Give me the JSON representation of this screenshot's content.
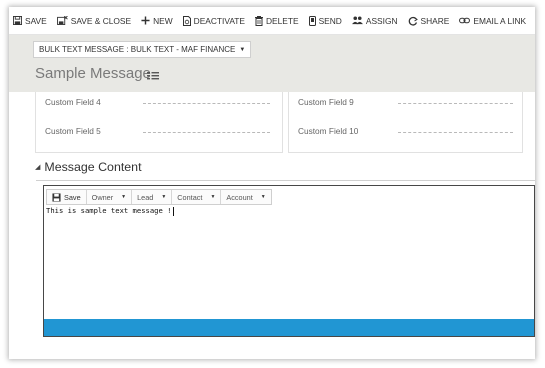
{
  "toolbar": {
    "items": [
      {
        "label": "SAVE",
        "icon": "save-icon"
      },
      {
        "label": "SAVE & CLOSE",
        "icon": "save-close-icon"
      },
      {
        "label": "NEW",
        "icon": "plus-icon"
      },
      {
        "label": "DEACTIVATE",
        "icon": "deactivate-icon"
      },
      {
        "label": "DELETE",
        "icon": "trash-icon"
      },
      {
        "label": "SEND",
        "icon": "send-icon"
      },
      {
        "label": "ASSIGN",
        "icon": "assign-icon"
      },
      {
        "label": "SHARE",
        "icon": "share-icon"
      },
      {
        "label": "EMAIL A LINK",
        "icon": "link-icon"
      }
    ],
    "more": "•••"
  },
  "header": {
    "entity": "BULK TEXT MESSAGE : BULK TEXT - MAF FINANCE",
    "title": "Sample Message"
  },
  "fields": {
    "left": [
      {
        "label": "Custom Field 4",
        "value": ""
      },
      {
        "label": "Custom Field 5",
        "value": ""
      }
    ],
    "right": [
      {
        "label": "Custom Field 9",
        "value": ""
      },
      {
        "label": "Custom Field 10",
        "value": ""
      }
    ]
  },
  "section": {
    "title": "Message Content"
  },
  "editor": {
    "save_label": "Save",
    "dropdowns": [
      "Owner",
      "Lead",
      "Contact",
      "Account"
    ],
    "text": "This is sample text message !"
  },
  "colors": {
    "accent": "#2196d3",
    "header_bg": "#e8e8e4"
  }
}
